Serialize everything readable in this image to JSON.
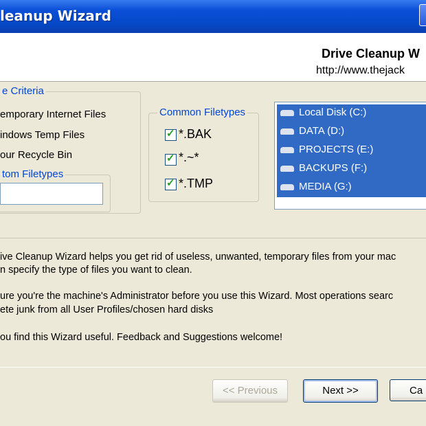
{
  "window": {
    "title": "leanup Wizard",
    "app_name": "Drive Cleanup W",
    "app_url": "http://www.thejack"
  },
  "criteria": {
    "legend": "e Criteria",
    "options": [
      {
        "label": "emporary Internet Files"
      },
      {
        "label": "indows Temp Files"
      },
      {
        "label": "our Recycle Bin"
      }
    ],
    "custom_legend": "tom Filetypes",
    "custom_value": ""
  },
  "filetypes": {
    "legend": "Common Filetypes",
    "items": [
      {
        "label": "*.BAK",
        "checked": true
      },
      {
        "label": "*.~*",
        "checked": true
      },
      {
        "label": "*.TMP",
        "checked": true
      }
    ]
  },
  "drives": [
    {
      "label": "Local Disk (C:)",
      "selected": true,
      "icon": "drive-icon"
    },
    {
      "label": "DATA (D:)",
      "selected": true,
      "icon": "drive-icon"
    },
    {
      "label": "PROJECTS (E:)",
      "selected": true,
      "icon": "drive-icon"
    },
    {
      "label": "BACKUPS (F:)",
      "selected": true,
      "icon": "drive-icon"
    },
    {
      "label": "MEDIA (G:)",
      "selected": true,
      "icon": "drive-icon"
    }
  ],
  "description": {
    "lines": [
      "ive Cleanup Wizard helps you get rid of useless, unwanted, temporary files from your mac",
      "n specify the type of files you want to clean.",
      "ure you're the machine's Administrator before you use this Wizard. Most operations searc",
      "ete junk from all User Profiles/chosen hard disks",
      "ou find this Wizard useful. Feedback and Suggestions welcome!"
    ]
  },
  "buttons": {
    "previous": "<< Previous",
    "next": "Next >>",
    "cancel": "Ca"
  },
  "colors": {
    "title_bar": "#0548c8",
    "selection": "#316ac5",
    "legend_text": "#0046d5",
    "dialog_bg": "#ece9d8"
  }
}
